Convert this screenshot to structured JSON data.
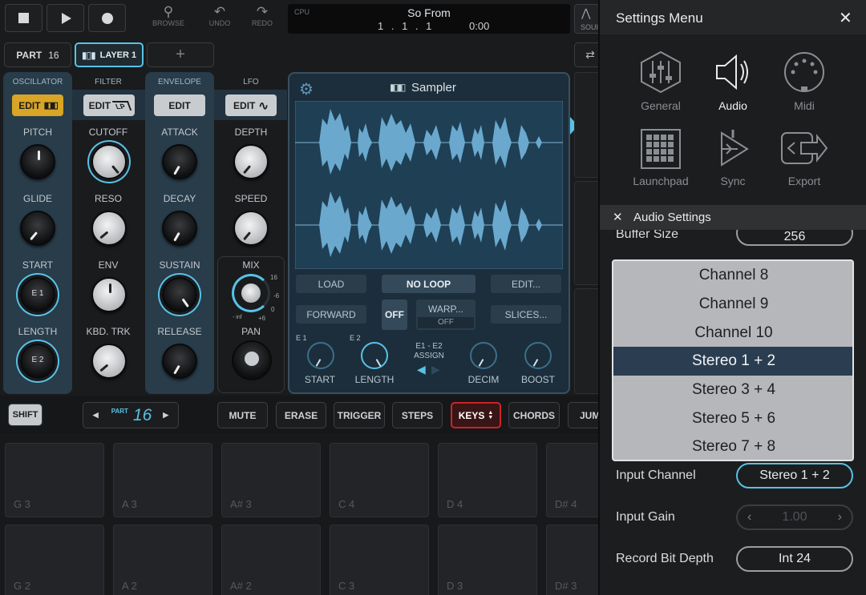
{
  "transport": {
    "browse": "BROWSE",
    "undo": "UNDO",
    "redo": "REDO",
    "cpu_label": "CPU",
    "song_title": "So From",
    "position": "1 . 1 . 1",
    "time": "0:00",
    "sound_partial": "SOUI"
  },
  "parts": {
    "part_label": "PART",
    "part_number": "16",
    "layer_label": "LAYER 1",
    "add": "+"
  },
  "sections": {
    "oscillator": "OSCILLATOR",
    "filter": "FILTER",
    "envelope": "ENVELOPE",
    "lfo": "LFO"
  },
  "edit_buttons": {
    "oscillator": "EDIT",
    "filter": "EDIT",
    "filter_sub": "LP",
    "envelope": "EDIT",
    "lfo": "EDIT"
  },
  "knobs": {
    "pitch": "PITCH",
    "glide": "GLIDE",
    "start": "START",
    "start_inner": "E 1",
    "length": "LENGTH",
    "length_inner": "E 2",
    "cutoff": "CUTOFF",
    "reso": "RESO",
    "env": "ENV",
    "kbd_trk": "KBD. TRK",
    "attack": "ATTACK",
    "decay": "DECAY",
    "sustain": "SUSTAIN",
    "release": "RELEASE",
    "depth": "DEPTH",
    "speed": "SPEED",
    "mix": "MIX",
    "mix_16": "16",
    "mix_6": "-6",
    "mix_0": "0",
    "mix_inf": "- inf",
    "mix_p6": "+6",
    "pan": "PAN"
  },
  "sampler": {
    "title": "Sampler",
    "load": "LOAD",
    "no_loop": "NO LOOP",
    "edit": "EDIT...",
    "forward": "FORWARD",
    "off": "OFF",
    "warp": "WARP...",
    "warp_value": "OFF",
    "slices": "SLICES...",
    "e1": "E 1",
    "e2": "E 2",
    "start": "START",
    "length": "LENGTH",
    "assign_title": "E1 - E2",
    "assign": "ASSIGN",
    "decim": "DECIM",
    "boost": "BOOST"
  },
  "bottom_bar": {
    "shift": "SHIFT",
    "part_small": "PART",
    "part_number": "16",
    "mute": "MUTE",
    "erase": "ERASE",
    "trigger": "TRIGGER",
    "steps": "STEPS",
    "keys": "KEYS",
    "chords": "CHORDS",
    "jump_partial": "JUM"
  },
  "pads": {
    "row1": [
      "G 3",
      "A 3",
      "A# 3",
      "C 4",
      "D 4",
      "D# 4"
    ],
    "row2": [
      "G 2",
      "A 2",
      "A# 2",
      "C 3",
      "D 3",
      "D# 3"
    ]
  },
  "settings": {
    "title": "Settings Menu",
    "icons": {
      "general": "General",
      "audio": "Audio",
      "midi": "Midi",
      "launchpad": "Launchpad",
      "sync": "Sync",
      "export": "Export"
    },
    "audio_settings_title": "Audio Settings",
    "buffer_size_label": "Buffer Size",
    "buffer_size_value": "256",
    "dropdown_options": [
      "Channel 8",
      "Channel 9",
      "Channel 10",
      "Stereo 1 + 2",
      "Stereo 3 + 4",
      "Stereo 5 + 6",
      "Stereo 7 + 8"
    ],
    "dropdown_selected": "Stereo 1 + 2",
    "input_channel_label": "Input Channel",
    "input_channel_value": "Stereo 1 + 2",
    "input_gain_label": "Input Gain",
    "input_gain_value": "1.00",
    "record_bit_depth_label": "Record Bit Depth",
    "record_bit_depth_value": "Int 24"
  },
  "colors": {
    "accent_blue": "#58c2e6",
    "oscillator_edit": "#d8a526",
    "keys_red": "#c9252a",
    "selected_row": "#2a3d51",
    "waveform": "#66a7cb"
  }
}
